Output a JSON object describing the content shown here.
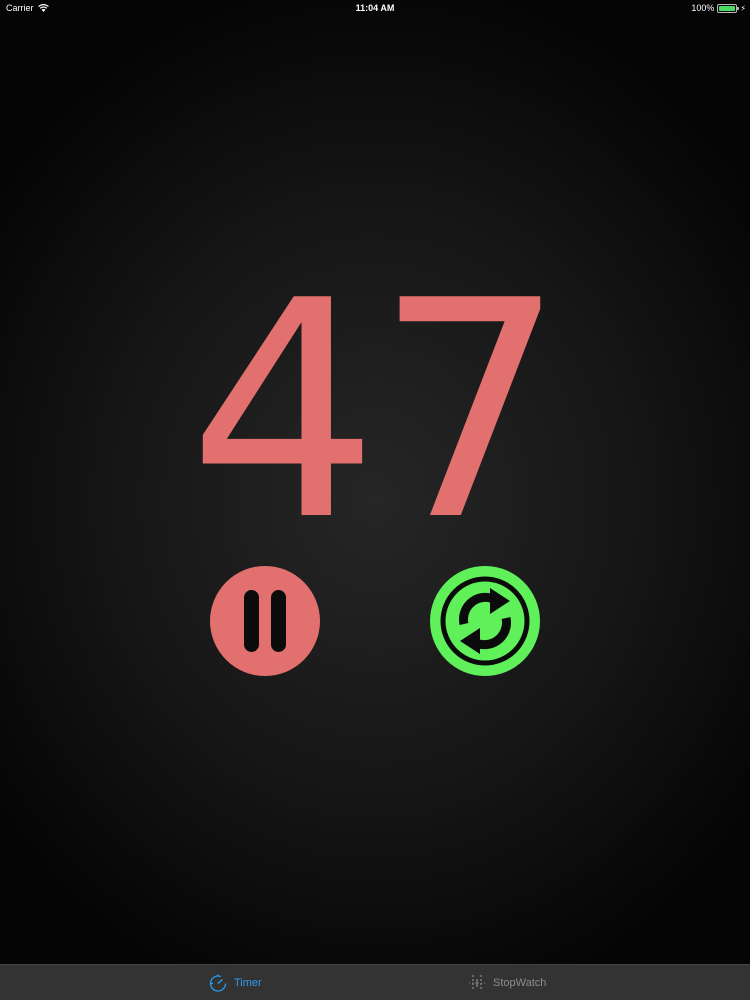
{
  "status_bar": {
    "carrier": "Carrier",
    "time": "11:04 AM",
    "battery": "100%",
    "battery_level": 1.0,
    "icons": [
      "wifi-icon",
      "battery-icon",
      "charging-bolt-icon"
    ]
  },
  "timer": {
    "value": "47",
    "color": "#e1706e"
  },
  "controls": {
    "pause_icon": "pause-icon",
    "pause_color": "#e1706e",
    "reset_icon": "refresh-arrows-icon",
    "reset_color": "#5ff05a"
  },
  "tab_bar": {
    "tabs": [
      {
        "label": "Timer",
        "icon": "timer-icon",
        "selected": true,
        "color": "#2d9cf0"
      },
      {
        "label": "StopWatch",
        "icon": "stopwatch-icon",
        "selected": false,
        "color": "#8e8e8e"
      }
    ]
  }
}
